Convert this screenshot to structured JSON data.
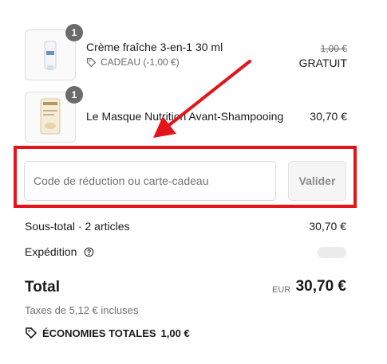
{
  "items": [
    {
      "name": "Crème fraîche 3-en-1 30 ml",
      "quantity": "1",
      "badge": "CADEAU (-1,00 €)",
      "badge_icon": "tag-icon",
      "original_price": "1,00 €",
      "price": "GRATUIT"
    },
    {
      "name": "Le Masque Nutrition Avant-Shampooing",
      "quantity": "1",
      "price": "30,70 €"
    }
  ],
  "discount": {
    "placeholder": "Code de réduction ou carte-cadeau",
    "value": "",
    "button_label": "Valider"
  },
  "summary": {
    "subtotal_label": "Sous-total · 2 articles",
    "subtotal_value": "30,70 €",
    "shipping_label": "Expédition",
    "shipping_icon": "help-circle-icon",
    "total_label": "Total",
    "currency": "EUR",
    "total_value": "30,70 €",
    "tax_note": "Taxes de 5,12 € incluses",
    "savings_icon": "tag-icon",
    "savings_label": "ÉCONOMIES TOTALES",
    "savings_value": "1,00 €"
  },
  "colors": {
    "annotation": "#e4141b",
    "badge_bg": "#6b6b6b",
    "muted_text": "#707070"
  }
}
